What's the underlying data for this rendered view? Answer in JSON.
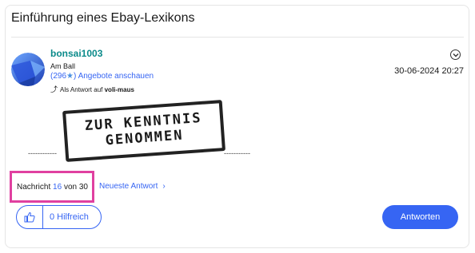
{
  "thread": {
    "title": "Einführung eines Ebay-Lexikons"
  },
  "post": {
    "author": {
      "username": "bonsai1003",
      "rank": "Am Ball",
      "feedback_score_open": "(296",
      "feedback_score_close": ")",
      "view_offers_label": "Angebote anschauen"
    },
    "reply_to": {
      "prefix": "Als Antwort auf",
      "username": "voli-maus"
    },
    "timestamp": "30-06-2024 20:27",
    "stamp": {
      "line1": "ZUR KENNTNIS",
      "line2": "GENOMMEN"
    },
    "dashes_left": "------------",
    "dashes_right": "-----------"
  },
  "pagination": {
    "message_label": "Nachricht",
    "current": "16",
    "of_label": "von",
    "total": "30",
    "latest_answer_label": "Neueste Antwort"
  },
  "actions": {
    "helpful_label": "0 Hilfreich",
    "answer_label": "Antworten"
  },
  "colors": {
    "accent": "#3665f3",
    "username": "#0a8a8a",
    "highlight_box": "#e040a0"
  }
}
